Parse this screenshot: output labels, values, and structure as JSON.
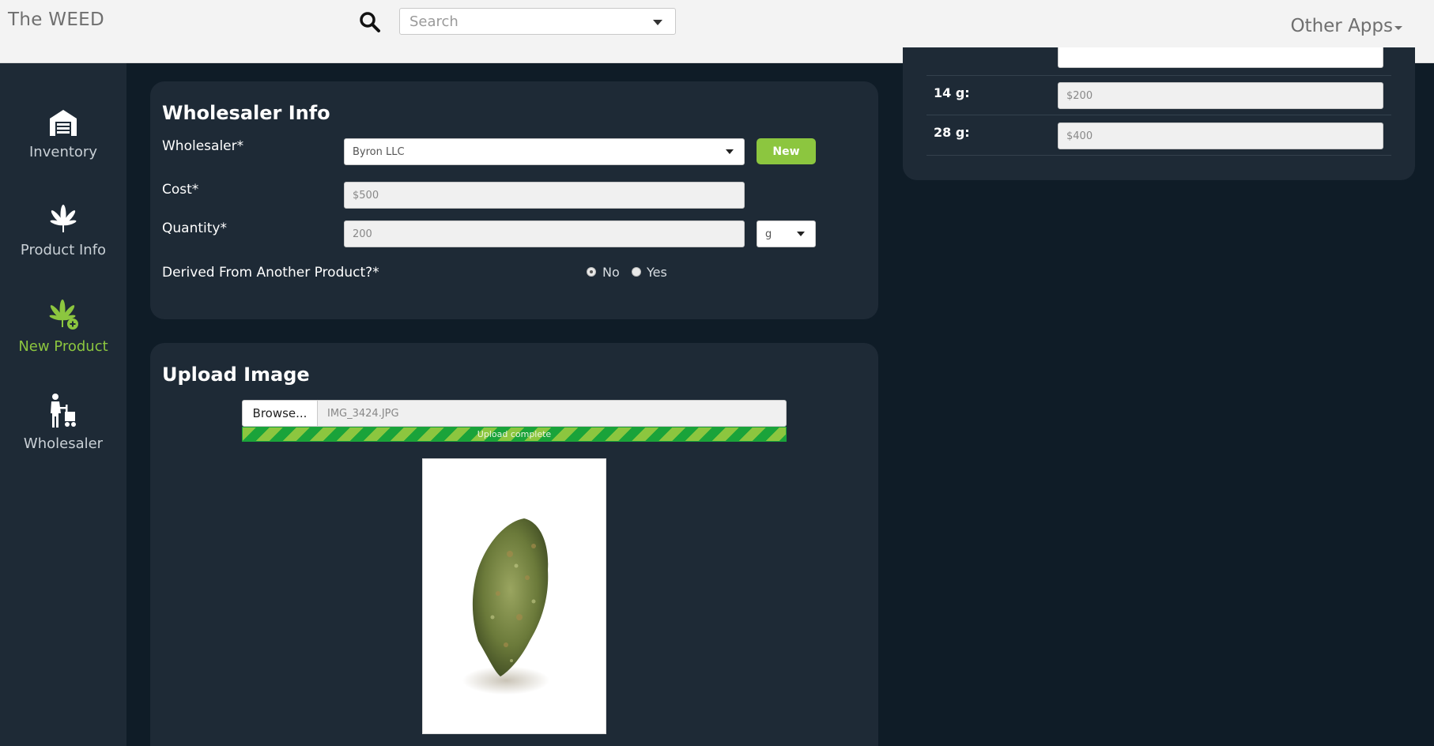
{
  "app": {
    "brand": "The WEED"
  },
  "header": {
    "search_placeholder": "Search",
    "other_apps_label": "Other Apps"
  },
  "sidebar": {
    "items": [
      {
        "label": "Inventory",
        "icon": "warehouse-icon",
        "active": false
      },
      {
        "label": "Product Info",
        "icon": "cannabis-leaf-icon",
        "active": false
      },
      {
        "label": "New Product",
        "icon": "cannabis-leaf-plus-icon",
        "active": true
      },
      {
        "label": "Wholesaler",
        "icon": "person-cart-icon",
        "active": false
      }
    ]
  },
  "wholesaler_info": {
    "title": "Wholesaler Info",
    "wholesaler_label": "Wholesaler*",
    "wholesaler_value": "Byron LLC",
    "new_button": "New",
    "cost_label": "Cost*",
    "cost_value": "$500",
    "quantity_label": "Quantity*",
    "quantity_value": "200",
    "unit_value": "g",
    "derived_label": "Derived From Another Product?*",
    "derived_options": [
      "No",
      "Yes"
    ],
    "derived_selected": "No"
  },
  "pricing": {
    "rows": [
      {
        "label": "14 g:",
        "value": "$200"
      },
      {
        "label": "28 g:",
        "value": "$400"
      }
    ]
  },
  "upload": {
    "title": "Upload Image",
    "browse_label": "Browse...",
    "file_name": "IMG_3424.JPG",
    "progress_text": "Upload complete",
    "progress_percent": 100
  },
  "colors": {
    "accent": "#8cc63f",
    "background": "#0f1c27",
    "panel": "#1e2a36",
    "topbar": "#f3f3f3"
  }
}
